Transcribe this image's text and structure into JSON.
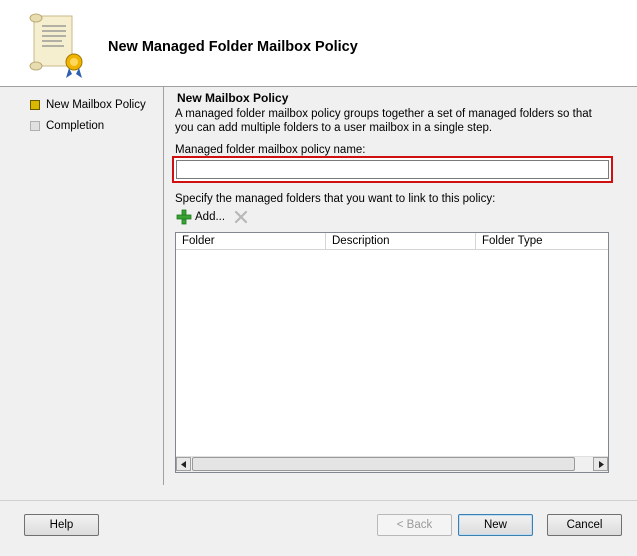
{
  "header": {
    "title": "New Managed Folder Mailbox Policy",
    "icon": "scroll-certificate-icon"
  },
  "steps": [
    {
      "label": "New Mailbox Policy",
      "state": "active"
    },
    {
      "label": "Completion",
      "state": "pending"
    }
  ],
  "main": {
    "section_title": "New Mailbox Policy",
    "description": "A managed folder mailbox policy groups together a set of managed folders so that you can add multiple folders to a user mailbox in a single step.",
    "name_label": "Managed folder mailbox policy name:",
    "name_value": "",
    "specify_label": "Specify the managed folders that you want to link to this policy:",
    "add_label": "Add...",
    "columns": [
      "Folder",
      "Description",
      "Folder Type"
    ],
    "rows": []
  },
  "buttons": {
    "help": "Help",
    "back": "< Back",
    "new": "New",
    "cancel": "Cancel"
  },
  "colors": {
    "highlight_border": "#d01010",
    "active_step": "#d8b800",
    "add_icon": "#3aa335"
  }
}
